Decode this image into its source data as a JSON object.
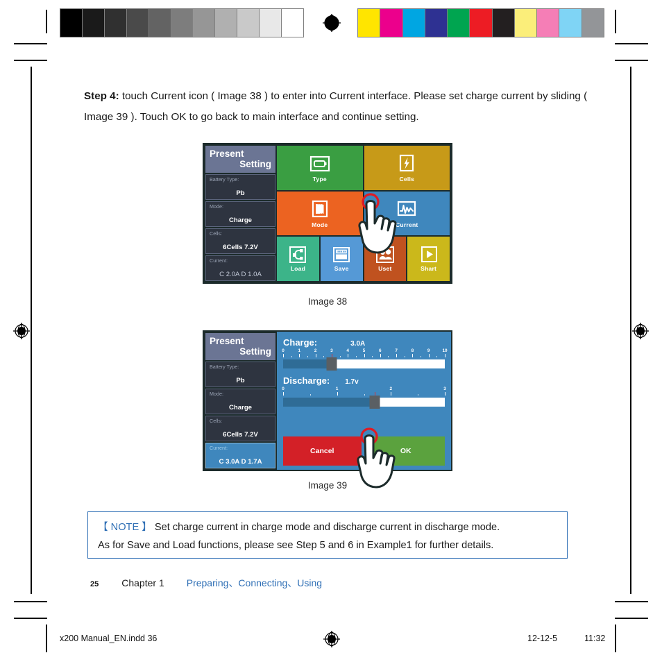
{
  "document": {
    "step_prefix": "Step 4:",
    "step_body": " touch Current icon ( Image 38 ) to enter into Current interface. Please set charge current by sliding ( Image 39 ). Touch OK to go back to main interface and continue setting.",
    "caption_38": "Image 38",
    "caption_39": "Image 39"
  },
  "note": {
    "keyword": "【 NOTE 】",
    "line1": " Set charge current in charge mode and discharge current in discharge mode.",
    "line2": "As for Save and Load functions, please see Step 5 and 6 in Example1 for further details."
  },
  "page_footer": {
    "page_number": "25",
    "chapter": "Chapter 1",
    "breadcrumb": "Preparing、Connecting、Using"
  },
  "print_footer": {
    "file": "x200 Manual_EN.indd   36",
    "date": "12-12-5",
    "time": "11:32"
  },
  "calibration": {
    "gray_swatches": [
      "#000000",
      "#1a1a1a",
      "#303030",
      "#4a4a4a",
      "#636363",
      "#7d7d7d",
      "#969696",
      "#b0b0b0",
      "#c9c9c9",
      "#e8e8e8",
      "#ffffff"
    ],
    "color_swatches": [
      "#ffe500",
      "#ec008c",
      "#00a6e2",
      "#2e3192",
      "#00a550",
      "#ed1c24",
      "#231f20",
      "#fbee7a",
      "#f57eb6",
      "#7fd4f5",
      "#939598"
    ]
  },
  "device38": {
    "sidebar": {
      "title_line1": "Present",
      "title_line2": "Setting",
      "rows": [
        {
          "label": "Battery Type:",
          "value": "Pb",
          "highlight": false,
          "dim": false
        },
        {
          "label": "Mode:",
          "value": "Charge",
          "highlight": false,
          "dim": false
        },
        {
          "label": "Cells:",
          "value": "6Cells  7.2V",
          "highlight": false,
          "dim": false
        },
        {
          "label": "Current:",
          "value": "C 2.0A  D 1.0A",
          "highlight": false,
          "dim": true
        }
      ]
    },
    "tiles": [
      [
        {
          "label": "Type",
          "icon": "battery-icon",
          "color": "#3a9e42"
        },
        {
          "label": "Cells",
          "icon": "lightning-bolt-icon",
          "color": "#c79a18"
        }
      ],
      [
        {
          "label": "Mode",
          "icon": "stacked-cards-icon",
          "color": "#ec6321"
        },
        {
          "label": "Current",
          "icon": "waveform-icon",
          "color": "#3f87bd"
        }
      ],
      [
        {
          "label": "Load",
          "icon": "load-network-icon",
          "color": "#3cb489"
        },
        {
          "label": "Save",
          "icon": "save-drawer-icon",
          "color": "#5599d6"
        },
        {
          "label": "Uset",
          "icon": "users-icon",
          "color": "#c0521f"
        },
        {
          "label": "Shart",
          "icon": "play-start-icon",
          "color": "#cbb81b"
        }
      ]
    ],
    "tap_target": "Current"
  },
  "device39": {
    "sidebar": {
      "title_line1": "Present",
      "title_line2": "Setting",
      "rows": [
        {
          "label": "Battery Type:",
          "value": "Pb",
          "highlight": false,
          "dim": false
        },
        {
          "label": "Mode:",
          "value": "Charge",
          "highlight": false,
          "dim": false
        },
        {
          "label": "Cells:",
          "value": "6Cells  7.2V",
          "highlight": false,
          "dim": false
        },
        {
          "label": "Current:",
          "value": "C 3.0A  D 1.7A",
          "highlight": true,
          "dim": false
        }
      ]
    },
    "charge": {
      "title": "Charge:",
      "value": "3.0A",
      "min": 0,
      "max": 10,
      "current": 3.0,
      "ticks": [
        "0",
        "1",
        "2",
        "3",
        "4",
        "5",
        "6",
        "7",
        "8",
        "9",
        "10"
      ]
    },
    "discharge": {
      "title": "Discharge:",
      "value": "1.7v",
      "min": 0,
      "max": 3,
      "current": 1.7,
      "ticks": [
        "0",
        "1",
        "2",
        "3"
      ]
    },
    "buttons": {
      "cancel": "Cancel",
      "ok": "OK"
    },
    "tap_target": "OK"
  }
}
